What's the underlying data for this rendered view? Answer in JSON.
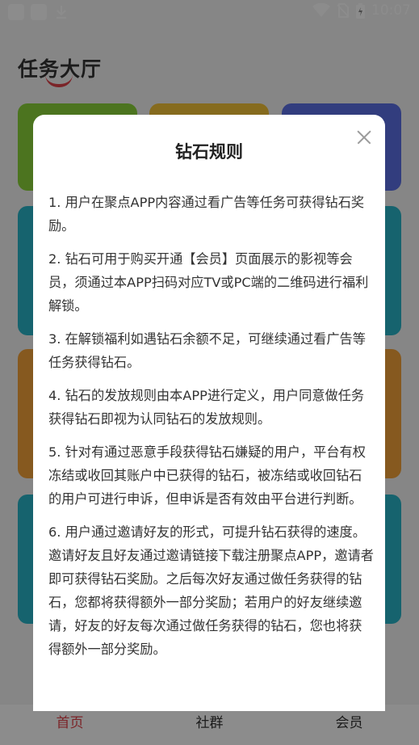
{
  "status_bar": {
    "time": "10:07"
  },
  "page": {
    "title": "任务大厅"
  },
  "bottom_nav": [
    {
      "label": "首页",
      "active": true
    },
    {
      "label": "社群",
      "active": false
    },
    {
      "label": "会员",
      "active": false
    }
  ],
  "dialog": {
    "title": "钻石规则",
    "rules": [
      "1. 用户在聚点APP内容通过看广告等任务可获得钻石奖励。",
      "2. 钻石可用于购买开通【会员】页面展示的影视等会员，须通过本APP扫码对应TV或PC端的二维码进行福利解锁。",
      "3. 在解锁福利如遇钻石余额不足，可继续通过看广告等任务获得钻石。",
      "4. 钻石的发放规则由本APP进行定义，用户同意做任务获得钻石即视为认同钻石的发放规则。",
      "5. 针对有通过恶意手段获得钻石嫌疑的用户，平台有权冻结或收回其账户中已获得的钻石，被冻结或收回钻石的用户可进行申诉，但申诉是否有效由平台进行判断。",
      "6. 用户通过邀请好友的形式，可提升钻石获得的速度。邀请好友且好友通过邀请链接下载注册聚点APP，邀请者即可获得钻石奖励。之后每次好友通过做任务获得的钻石，您都将获得额外一部分奖励；若用户的好友继续邀请，好友的好友每次通过做任务获得的钻石，您也将获得额外一部分奖励。"
    ]
  },
  "colors": {
    "accent": "#e0424a",
    "card_green": "#8bd43a",
    "card_yellow": "#f5c338",
    "card_blue": "#5b70e6",
    "card_teal": "#29b5c8",
    "card_orange": "#f5a23a"
  }
}
